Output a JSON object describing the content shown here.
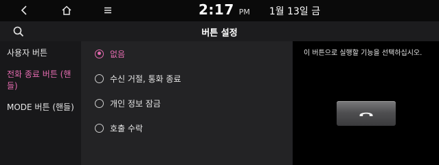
{
  "status_bar": {
    "time": "2:17",
    "ampm": "PM",
    "date": "1월 13일 금",
    "icons": [
      "back-icon",
      "home-icon",
      "menu-icon"
    ]
  },
  "header": {
    "title": "버튼 설정",
    "search_icon": "search-icon"
  },
  "sidebar": {
    "items": [
      {
        "label": "사용자 버튼",
        "active": false
      },
      {
        "label": "전화 종료 버튼 (핸들)",
        "active": true
      },
      {
        "label": "MODE 버튼 (핸들)",
        "active": false
      }
    ]
  },
  "options": {
    "items": [
      {
        "label": "없음",
        "selected": true
      },
      {
        "label": "수신 거절, 통화 종료",
        "selected": false
      },
      {
        "label": "개인 정보 잠금",
        "selected": false
      },
      {
        "label": "호출 수락",
        "selected": false
      }
    ]
  },
  "detail": {
    "description": "이 버튼으로 실행할 기능을 선택하십시오.",
    "button_icon": "end-call-icon"
  },
  "colors": {
    "accent": "#e46bb0",
    "background": "#000000",
    "panel": "#232325",
    "sidebar": "#18181a"
  }
}
